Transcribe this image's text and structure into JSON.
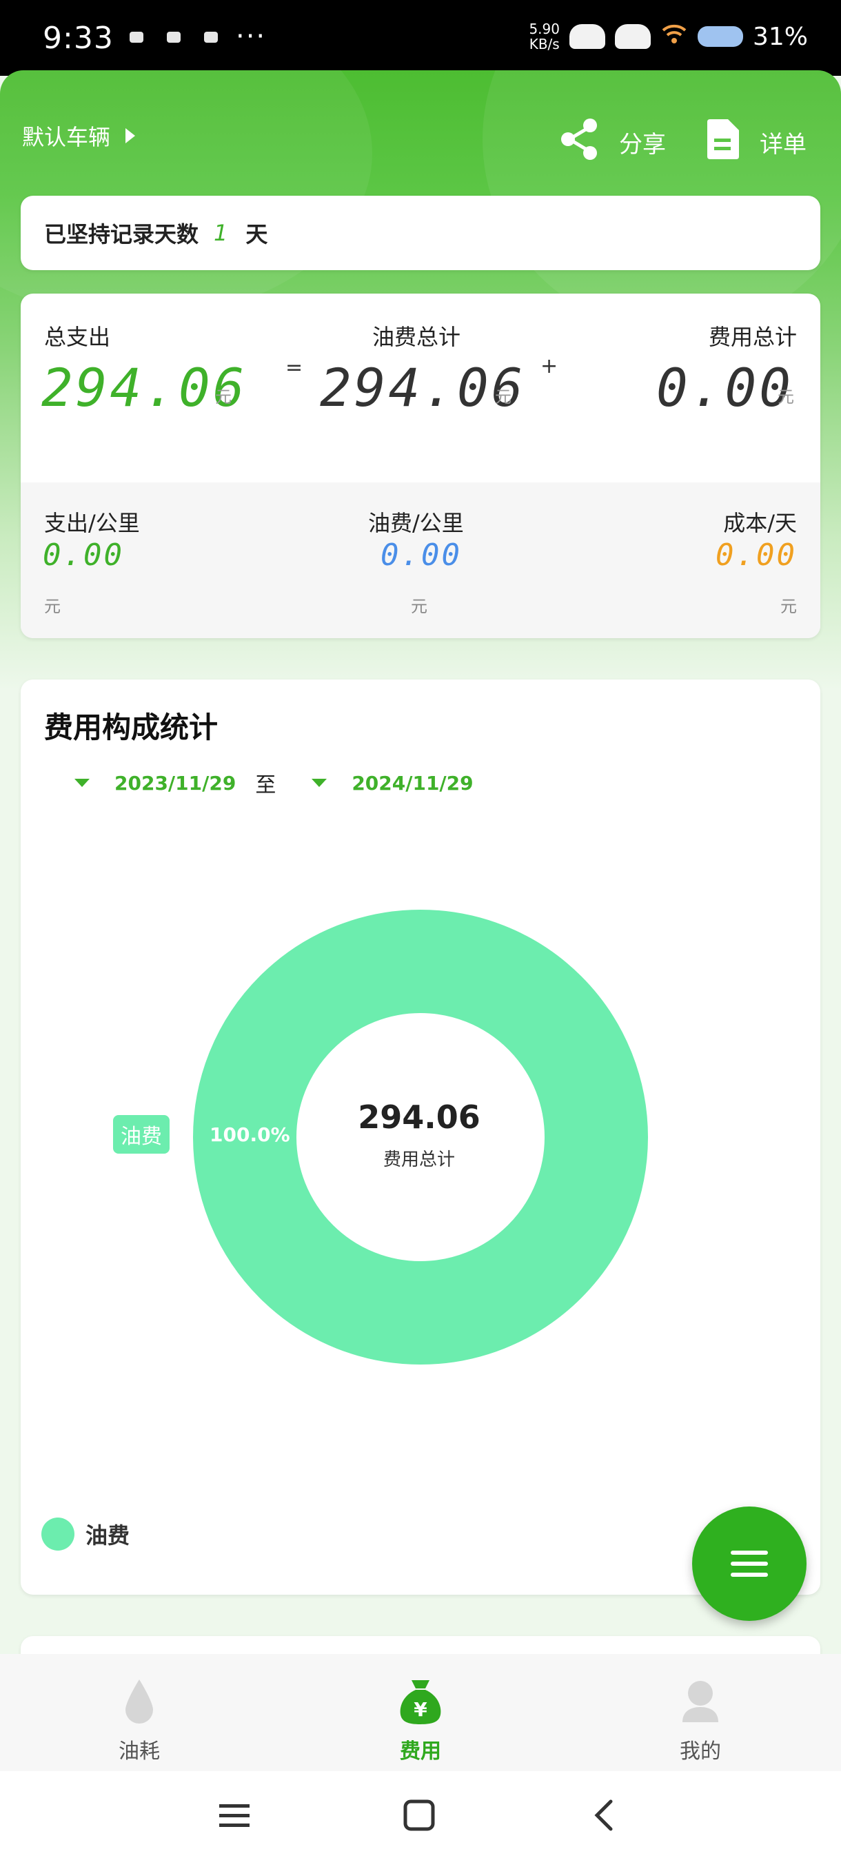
{
  "status_bar": {
    "time": "9:33",
    "more": "···",
    "net_speed_value": "5.90",
    "net_speed_unit": "KB/s",
    "battery": "31%",
    "icons": [
      "notification-icon",
      "cloud-signal-icon",
      "hd-cloud-signal-icon",
      "wifi-icon",
      "battery-icon"
    ]
  },
  "header": {
    "vehicle": "默认车辆",
    "share": "分享",
    "detail": "详单"
  },
  "streak": {
    "prefix": "已坚持记录天数",
    "days": "1",
    "suffix": "天"
  },
  "summary": {
    "total_label": "总支出",
    "total_value": "294.06",
    "fuel_label": "油费总计",
    "fuel_value": "294.06",
    "fee_label": "费用总计",
    "fee_value": "0.00",
    "unit": "元",
    "equals": "=",
    "plus": "+",
    "per_km_label": "支出/公里",
    "per_km_value": "0.00",
    "fuel_per_km_label": "油费/公里",
    "fuel_per_km_value": "0.00",
    "cost_per_day_label": "成本/天",
    "cost_per_day_value": "0.00"
  },
  "colors": {
    "brand": "#3fb12a",
    "fuel_per_km": "#4a8ee8",
    "cost_per_day": "#f0a020",
    "slice": "#6cedae"
  },
  "stats": {
    "title": "费用构成统计",
    "start_date": "2023/11/29",
    "to": "至",
    "end_date": "2024/11/29",
    "center_value": "294.06",
    "center_label": "费用总计"
  },
  "chart_data": {
    "type": "pie",
    "categories": [
      "油费"
    ],
    "values": [
      294.06
    ],
    "percent_labels": [
      "100.0%"
    ],
    "legend": [
      "油费"
    ],
    "legend_position": "bottom-left",
    "donut": true
  },
  "tabs": [
    {
      "label": "油耗",
      "icon": "droplet-icon",
      "active": false
    },
    {
      "label": "费用",
      "icon": "money-bag-icon",
      "active": true
    },
    {
      "label": "我的",
      "icon": "user-icon",
      "active": false
    }
  ]
}
